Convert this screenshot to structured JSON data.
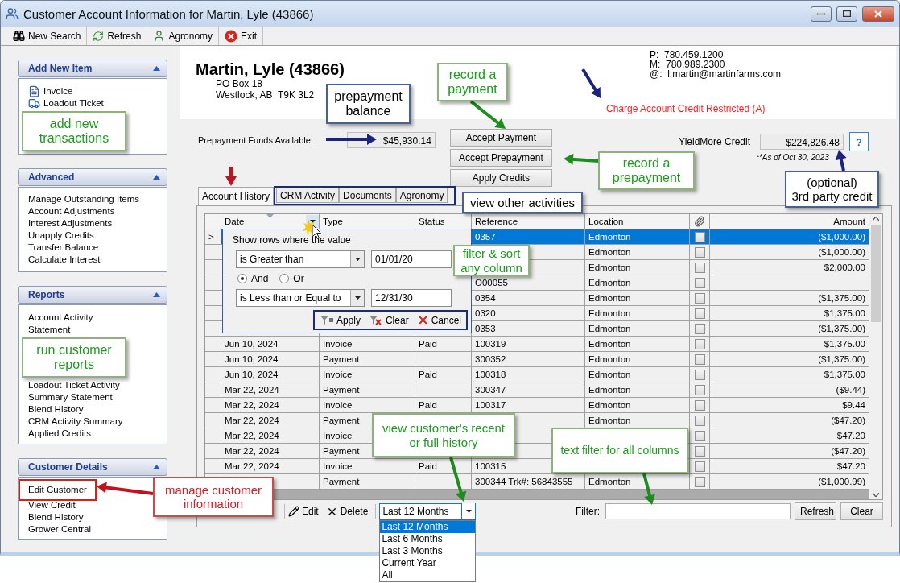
{
  "window": {
    "title": "Customer Account Information for Martin, Lyle (43866)"
  },
  "toolbar": [
    {
      "label": "New Search",
      "kind": "search"
    },
    {
      "label": "Refresh",
      "kind": "refresh"
    },
    {
      "label": "Agronomy",
      "kind": "person"
    },
    {
      "label": "Exit",
      "kind": "exit"
    }
  ],
  "sidebar": [
    {
      "title": "Add New Item",
      "expanded": true,
      "items": [
        {
          "kind": "invoice",
          "label": "Invoice"
        },
        {
          "kind": "ticket",
          "label": "Loadout Ticket"
        },
        {
          "kind": "callout",
          "label": "add new\ntransactions"
        }
      ]
    },
    {
      "title": "Advanced",
      "expanded": true,
      "items": [
        {
          "kind": "link",
          "label": "Manage Outstanding Items"
        },
        {
          "kind": "link",
          "label": "Account Adjustments"
        },
        {
          "kind": "link",
          "label": "Interest Adjustments"
        },
        {
          "kind": "link",
          "label": "Unapply Credits"
        },
        {
          "kind": "link",
          "label": "Transfer Balance"
        },
        {
          "kind": "link",
          "label": "Calculate Interest"
        }
      ]
    },
    {
      "title": "Reports",
      "expanded": true,
      "items": [
        {
          "kind": "link",
          "label": "Account Activity"
        },
        {
          "kind": "link",
          "label": "Statement"
        },
        {
          "kind": "callout",
          "label": "run customer\nreports"
        },
        {
          "kind": "link",
          "label": "Loadout Ticket Activity"
        },
        {
          "kind": "link",
          "label": "Summary Statement"
        },
        {
          "kind": "link",
          "label": "Blend History"
        },
        {
          "kind": "link",
          "label": "CRM Activity Summary"
        },
        {
          "kind": "link",
          "label": "Applied Credits"
        }
      ]
    },
    {
      "title": "Customer Details",
      "expanded": true,
      "items": [
        {
          "kind": "link",
          "label": "Edit Customer",
          "highlighted": true
        },
        {
          "kind": "link",
          "label": "View Credit",
          "highlighted": false
        },
        {
          "kind": "link",
          "label": "Blend History",
          "highlighted": false
        },
        {
          "kind": "link",
          "label": "Grower Central",
          "highlighted": false
        }
      ]
    }
  ],
  "customer": {
    "name": "Martin, Lyle (43866)",
    "address": [
      "PO Box 18",
      "Westlock, AB  T9K 3L2"
    ],
    "contacts": [
      "P:  780.459.1200",
      "M:  780.989.2300",
      "@:  l.martin@martinfarms.com"
    ],
    "status": "Charge Account Credit Restricted (A)"
  },
  "prepayment": {
    "label": "Prepayment Funds Available:",
    "value": "$45,930.14"
  },
  "actions": [
    "Accept Payment",
    "Accept Prepayment",
    "Apply Credits"
  ],
  "third_party": {
    "label": "YieldMore Credit",
    "value": "$224,826.48",
    "help": "?",
    "note": "**As of Oct 30, 2023"
  },
  "tabs": [
    {
      "label": "Account History",
      "selected": true
    },
    {
      "label": "CRM Activity",
      "selected": false
    },
    {
      "label": "Documents",
      "selected": false
    },
    {
      "label": "Agronomy",
      "selected": false
    }
  ],
  "grid": {
    "columns": [
      {
        "label": "Date",
        "kind": "text",
        "sorted": true,
        "filter_button": true
      },
      {
        "label": "Type",
        "kind": "text",
        "sorted": false,
        "filter_button": false
      },
      {
        "label": "Status",
        "kind": "text",
        "sorted": false,
        "filter_button": false
      },
      {
        "label": "Reference",
        "kind": "text",
        "sorted": false,
        "filter_button": false
      },
      {
        "label": "Location",
        "kind": "text",
        "sorted": false,
        "filter_button": false
      },
      {
        "kind": "attachment",
        "sorted": false,
        "filter_button": false
      },
      {
        "label": "Amount",
        "kind": "amount",
        "sorted": false,
        "filter_button": false
      }
    ],
    "rows": [
      {
        "marker": ">",
        "selected": true,
        "reference": "0357",
        "location": "Edmonton",
        "attached": false,
        "amount": "($1,000.00)"
      },
      {
        "selected": false,
        "location": "Edmonton",
        "attached": false,
        "amount": "($1,000.00)"
      },
      {
        "selected": false,
        "location": "Edmonton",
        "attached": false,
        "amount": "$2,000.00"
      },
      {
        "selected": false,
        "reference": "O00055",
        "location": "Edmonton",
        "attached": false
      },
      {
        "selected": false,
        "reference": "0354",
        "location": "Edmonton",
        "attached": false,
        "amount": "($1,375.00)"
      },
      {
        "selected": false,
        "reference": "0320",
        "location": "Edmonton",
        "attached": false,
        "amount": "$1,375.00"
      },
      {
        "selected": false,
        "reference": "0353",
        "location": "Edmonton",
        "attached": false,
        "amount": "($1,375.00)"
      },
      {
        "selected": false,
        "date": "Jun 10, 2024",
        "type": "Invoice",
        "status": "Paid",
        "reference": "100319",
        "location": "Edmonton",
        "attached": false,
        "amount": "$1,375.00"
      },
      {
        "selected": false,
        "date": "Jun 10, 2024",
        "type": "Payment",
        "reference": "300352",
        "location": "Edmonton",
        "attached": false,
        "amount": "($1,375.00)"
      },
      {
        "selected": false,
        "date": "Jun 10, 2024",
        "type": "Invoice",
        "status": "Paid",
        "reference": "100318",
        "location": "Edmonton",
        "attached": false,
        "amount": "$1,375.00"
      },
      {
        "selected": false,
        "date": "Mar 22, 2024",
        "type": "Payment",
        "reference": "300347",
        "location": "Edmonton",
        "attached": false,
        "amount": "($9.44)"
      },
      {
        "selected": false,
        "date": "Mar 22, 2024",
        "type": "Invoice",
        "status": "Paid",
        "reference": "100317",
        "location": "Edmonton",
        "attached": false,
        "amount": "$9.44"
      },
      {
        "selected": false,
        "date": "Mar 22, 2024",
        "type": "Payment",
        "location": "Edmonton",
        "attached": false,
        "amount": "($47.20)"
      },
      {
        "selected": false,
        "date": "Mar 22, 2024",
        "type": "Invoice",
        "attached": false,
        "amount": "$47.20"
      },
      {
        "selected": false,
        "date": "Mar 22, 2024",
        "type": "Payment",
        "attached": false,
        "amount": "($47.20)"
      },
      {
        "selected": false,
        "date": "Mar 22, 2024",
        "type": "Invoice",
        "status": "Paid",
        "reference": "100315",
        "attached": false,
        "amount": "$47.20"
      },
      {
        "selected": false,
        "type": "Payment",
        "reference": "300344 Trk#: 56843555",
        "location": "Edmonton",
        "attached": false,
        "amount": "($1,000.99)"
      }
    ],
    "filter_popup": {
      "prompt": "Show rows where the value",
      "conditions": [
        {
          "operator": "is Greater than",
          "value": "01/01/20"
        },
        {
          "operator": "is Less than or Equal to",
          "value": "12/31/30"
        }
      ],
      "joins": [
        {
          "label": "And",
          "selected": true
        },
        {
          "label": "Or",
          "selected": false
        }
      ],
      "buttons": [
        {
          "label": "Apply",
          "kind": "apply"
        },
        {
          "label": "Clear",
          "kind": "clear"
        },
        {
          "label": "Cancel",
          "kind": "cancel"
        }
      ]
    }
  },
  "footer": {
    "actions": [
      {
        "label": "Edit",
        "kind": "edit"
      },
      {
        "label": "Delete",
        "kind": "delete"
      }
    ],
    "range": {
      "value": "Last 12 Months",
      "open": true,
      "options": [
        {
          "label": "Last 12 Months",
          "selected": true
        },
        {
          "label": "Last 6 Months",
          "selected": false
        },
        {
          "label": "Last 3 Months",
          "selected": false
        },
        {
          "label": "Current Year",
          "selected": false
        },
        {
          "label": "All",
          "selected": false
        }
      ]
    },
    "filter": {
      "label": "Filter:"
    },
    "buttons": [
      "Refresh",
      "Clear"
    ]
  },
  "annotations": [
    {
      "kind": "green",
      "text": "record a\npayment"
    },
    {
      "kind": "navy",
      "text": "prepayment\nbalance"
    },
    {
      "kind": "green",
      "text": "record a\nprepayment"
    },
    {
      "kind": "navy",
      "text": "view other activities"
    },
    {
      "kind": "navy",
      "text": "(optional)\n3rd party credit"
    },
    {
      "kind": "green",
      "text": "filter & sort\nany column"
    },
    {
      "kind": "green",
      "text": "view customer's recent\nor full history"
    },
    {
      "kind": "green",
      "text": "text filter for all columns"
    },
    {
      "kind": "red",
      "text": "manage customer\ninformation"
    }
  ]
}
